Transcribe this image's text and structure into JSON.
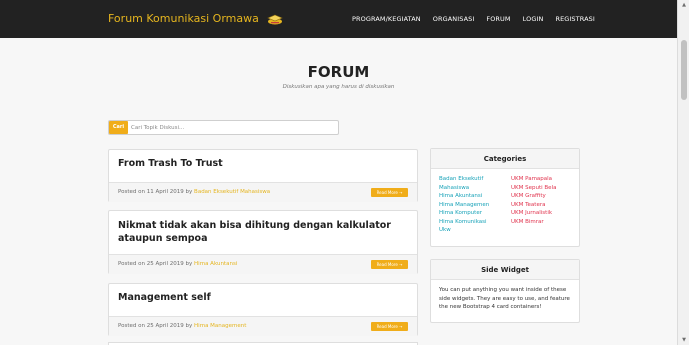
{
  "navbar": {
    "brand": "Forum Komunikasi Ormawa",
    "logo_icon": "graduation-cap-icon",
    "links": [
      "PROGRAM/KEGIATAN",
      "ORGANISASI",
      "FORUM",
      "LOGIN",
      "REGISTRASI"
    ]
  },
  "header": {
    "title": "FORUM",
    "subtitle": "Diskusikan apa yang harus di diskusikan"
  },
  "search": {
    "button_label": "Cari",
    "placeholder": "Cari Topik Diskusi..."
  },
  "posts": [
    {
      "title": "From Trash To Trust",
      "meta_prefix": "Posted on 11 April 2019 by",
      "author": "Badan Eksekutif Mahasiswa",
      "read_more": "Read More →"
    },
    {
      "title": "Nikmat tidak akan bisa dihitung dengan kalkulator ataupun sempoa",
      "meta_prefix": "Posted on 25 April 2019 by",
      "author": "Hima Akuntansi",
      "read_more": "Read More →"
    },
    {
      "title": "Management self",
      "meta_prefix": "Posted on 25 April 2019 by",
      "author": "Hima Management",
      "read_more": "Read More →"
    }
  ],
  "categories": {
    "heading": "Categories",
    "left": [
      "Badan Eksekutif",
      "Mahasiswa",
      "Hima Akuntansi",
      "Hima Managemen",
      "Hima Komputer",
      "Hima Komunikasi",
      "Ukw"
    ],
    "right": [
      "UKM Pamapala",
      "UKM Seputi Bela",
      "UKM Graffity",
      "UKM Teatera",
      "UKM Jurnalistik",
      "UKM Bimrar"
    ]
  },
  "side_widget": {
    "heading": "Side Widget",
    "text": "You can put anything you want inside of these side widgets. They are easy to use, and feature the new Bootstrap 4 card containers!"
  },
  "colors": {
    "navbar": "#222222",
    "brand": "#e5b51f",
    "accent_button": "#f0ad1a",
    "category_left": "#17a2b8",
    "category_right": "#e0334d"
  }
}
